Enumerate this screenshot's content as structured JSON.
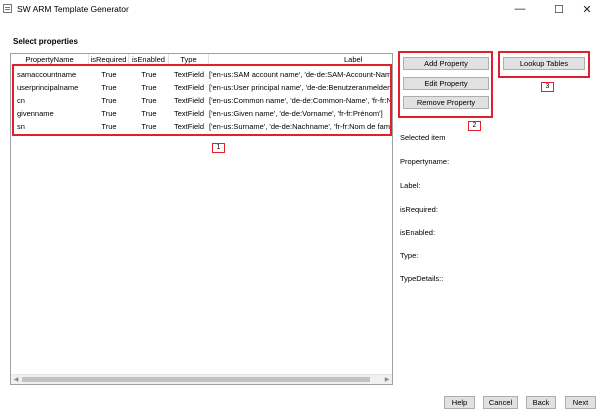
{
  "window": {
    "title": "SW ARM Template Generator",
    "controls": {
      "minimize": "—",
      "maximize": "☐",
      "close": "✕"
    }
  },
  "section_title": "Select properties",
  "grid": {
    "columns": [
      "PropertyName",
      "isRequired",
      "isEnabled",
      "Type",
      "Label"
    ],
    "rows": [
      {
        "name": "samaccountname",
        "required": "True",
        "enabled": "True",
        "type": "TextField",
        "label": "['en-us:SAM account name', 'de-de:SAM-Account-Name"
      },
      {
        "name": "userprincipalname",
        "required": "True",
        "enabled": "True",
        "type": "TextField",
        "label": "['en-us:User principal name', 'de-de:Benutzeranmeldena"
      },
      {
        "name": "cn",
        "required": "True",
        "enabled": "True",
        "type": "TextField",
        "label": "['en-us:Common name', 'de-de:Common-Name', 'fr-fr:N"
      },
      {
        "name": "givenname",
        "required": "True",
        "enabled": "True",
        "type": "TextField",
        "label": "['en-us:Given name', 'de-de:Vorname', 'fr-fr:Prénom']"
      },
      {
        "name": "sn",
        "required": "True",
        "enabled": "True",
        "type": "TextField",
        "label": "['en-us:Surname', 'de-de:Nachname', 'fr-fr:Nom de fami"
      }
    ]
  },
  "actions": {
    "add": "Add Property",
    "edit": "Edit Property",
    "remove": "Remove Property",
    "lookup": "Lookup Tables"
  },
  "badges": {
    "grid": "1",
    "actions": "2",
    "lookup": "3"
  },
  "details": {
    "heading": "Selected item",
    "propertyname": "Propertyname:",
    "label": "Label:",
    "isrequired": "isRequired:",
    "isenabled": "isEnabled:",
    "type": "Type:",
    "typedetails": "TypeDetails::"
  },
  "footer": {
    "help": "Help",
    "cancel": "Cancel",
    "back": "Back",
    "next": "Next"
  },
  "colors": {
    "highlight": "#e0202a",
    "button_bg": "#e1e1e1",
    "grid_border": "#a0a0a0"
  }
}
